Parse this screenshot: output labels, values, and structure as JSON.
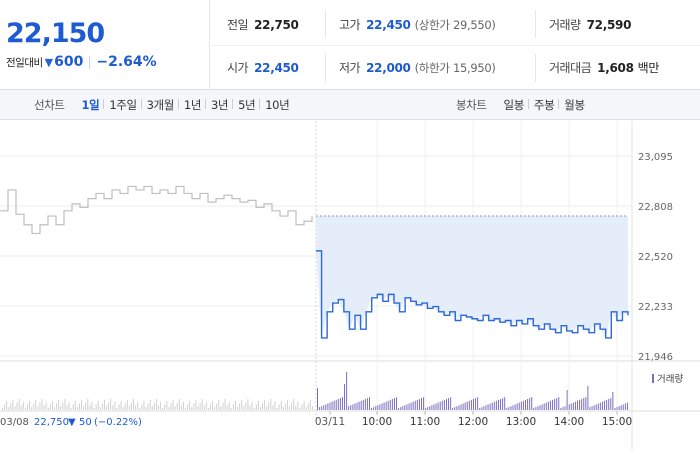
{
  "summary": {
    "price": "22,150",
    "change_label": "전일대비",
    "change_arrow": "▼",
    "change_value": "600",
    "change_rate": "−2.64%"
  },
  "info": {
    "prev_close": {
      "label": "전일",
      "value": "22,750"
    },
    "open": {
      "label": "시가",
      "value": "22,450"
    },
    "high": {
      "label": "고가",
      "value": "22,450",
      "sub": "(상한가 29,550)"
    },
    "low": {
      "label": "저가",
      "value": "22,000",
      "sub": "(하한가 15,950)"
    },
    "volume": {
      "label": "거래량",
      "value": "72,590"
    },
    "amount": {
      "label": "거래대금",
      "value": "1,608",
      "unit": "백만"
    }
  },
  "line_tabs": {
    "title": "선차트",
    "items": [
      {
        "label": "1일",
        "active": true
      },
      {
        "label": "1주일",
        "active": false
      },
      {
        "label": "3개월",
        "active": false
      },
      {
        "label": "1년",
        "active": false
      },
      {
        "label": "3년",
        "active": false
      },
      {
        "label": "5년",
        "active": false
      },
      {
        "label": "10년",
        "active": false
      }
    ]
  },
  "candle_tabs": {
    "title": "봉차트",
    "items": [
      {
        "label": "일봉"
      },
      {
        "label": "주봉"
      },
      {
        "label": "월봉"
      }
    ]
  },
  "chart_data": {
    "type": "line",
    "y_ticks": [
      "23,095",
      "22,808",
      "22,520",
      "22,233",
      "21,946"
    ],
    "ylim": [
      21946,
      23095
    ],
    "prev_close_line": 22750,
    "volume_legend": "거래량",
    "prev_day": {
      "date": "03/08",
      "close": "22,750",
      "change_arrow": "▼",
      "change": "50",
      "rate": "(−0.22%)"
    },
    "x_labels": [
      "03/11",
      "10:00",
      "11:00",
      "12:00",
      "13:00",
      "14:00",
      "15:00"
    ],
    "colors": {
      "prev_day_line": "#bfbfbf",
      "today_line": "#2d6ad9",
      "fill": "#e5edfa",
      "volume": "#7a6fbf",
      "volume_prev": "#d0d0d0"
    },
    "prev_day_series": [
      22780,
      22900,
      22760,
      22700,
      22650,
      22700,
      22750,
      22700,
      22780,
      22820,
      22800,
      22850,
      22880,
      22850,
      22900,
      22880,
      22920,
      22900,
      22920,
      22880,
      22900,
      22880,
      22920,
      22880,
      22850,
      22880,
      22830,
      22850,
      22870,
      22850,
      22830,
      22840,
      22800,
      22820,
      22780,
      22750,
      22780,
      22700,
      22720,
      22750
    ],
    "today_series": [
      22550,
      22050,
      22200,
      22250,
      22270,
      22200,
      22100,
      22180,
      22100,
      22200,
      22280,
      22300,
      22260,
      22300,
      22250,
      22200,
      22280,
      22260,
      22240,
      22250,
      22220,
      22230,
      22200,
      22180,
      22200,
      22150,
      22180,
      22170,
      22160,
      22150,
      22180,
      22150,
      22160,
      22140,
      22150,
      22120,
      22150,
      22130,
      22160,
      22120,
      22100,
      22130,
      22100,
      22080,
      22120,
      22090,
      22080,
      22120,
      22100,
      22080,
      22130,
      22100,
      22050,
      22200,
      22150,
      22200,
      22180
    ]
  }
}
